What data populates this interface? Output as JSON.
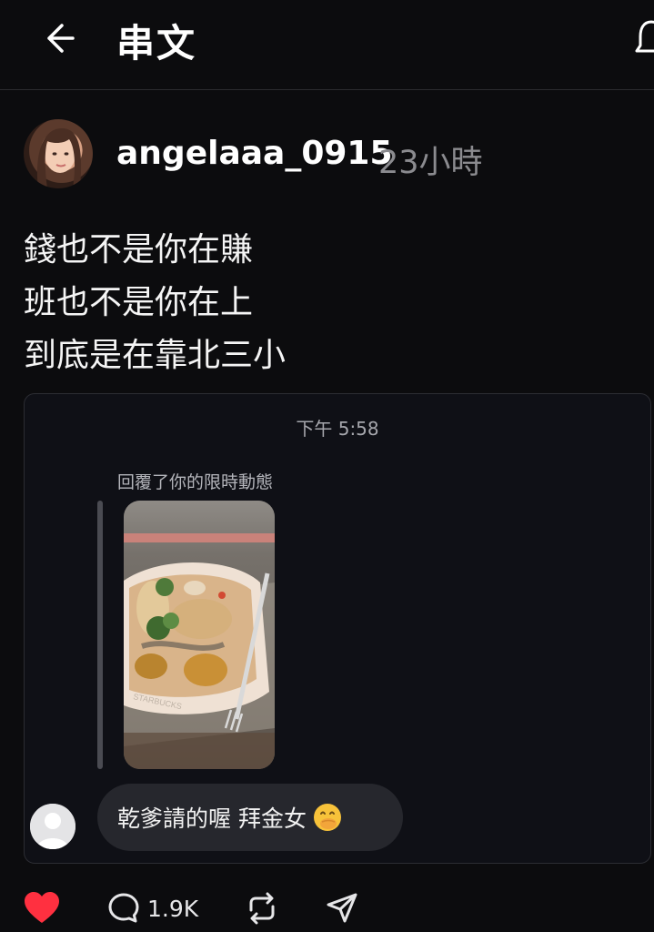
{
  "header": {
    "title": "串文",
    "back_icon": "back-arrow-icon",
    "right_icon": "notification-bell-icon"
  },
  "post": {
    "username": "angelaaa_0915",
    "time_ago": "23小時",
    "lines": [
      "錢也不是你在賺",
      "班也不是你在上",
      "到底是在靠北三小"
    ]
  },
  "embedded_screenshot": {
    "chat_time": "下午 5:58",
    "reply_caption": "回覆了你的限時動態",
    "story_image": "food-container-photo",
    "message": "乾爹請的喔 拜金女",
    "message_emoji": "face-with-hand-over-mouth-emoji"
  },
  "actions": {
    "like_icon": "heart-icon",
    "like_color": "#ff3040",
    "comment_icon": "comment-icon",
    "comment_count": "1.9K",
    "repost_icon": "repost-icon",
    "share_icon": "share-icon"
  },
  "colors": {
    "background": "#0c0c0e",
    "text": "#f3f3f3",
    "secondary_text": "#8b8b8f",
    "bubble": "#26272d"
  }
}
